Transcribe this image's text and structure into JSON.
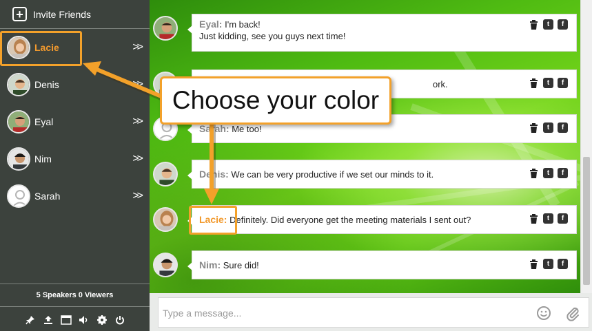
{
  "sidebar": {
    "invite_label": "Invite Friends",
    "users": [
      {
        "name": "Lacie",
        "active": true
      },
      {
        "name": "Denis",
        "active": false
      },
      {
        "name": "Eyal",
        "active": false
      },
      {
        "name": "Nim",
        "active": false
      },
      {
        "name": "Sarah",
        "active": false
      }
    ],
    "counts": "5 Speakers 0 Viewers",
    "tools": [
      "pin-icon",
      "upload-icon",
      "window-icon",
      "volume-icon",
      "gear-icon",
      "power-icon"
    ]
  },
  "messages": [
    {
      "author": "Eyal:",
      "line1": "I'm back!",
      "line2": "Just kidding, see you guys next time!"
    },
    {
      "author": "",
      "line1": "ork.",
      "line2": ""
    },
    {
      "author": "Sarah:",
      "line1": "Me too!",
      "line2": ""
    },
    {
      "author": "Denis:",
      "line1": "We can be very productive if we set our minds to it.",
      "line2": ""
    },
    {
      "author": "Lacie:",
      "line1": "Definitely. Did everyone get the meeting materials I sent out?",
      "line2": ""
    },
    {
      "author": "Nim:",
      "line1": "Sure did!",
      "line2": ""
    }
  ],
  "composer": {
    "placeholder": "Type a message..."
  },
  "annotation": {
    "text": "Choose your color"
  },
  "colors": {
    "accent": "#f3a12a",
    "sidebar": "#3c423d",
    "name_highlight": "#f29a2e"
  }
}
